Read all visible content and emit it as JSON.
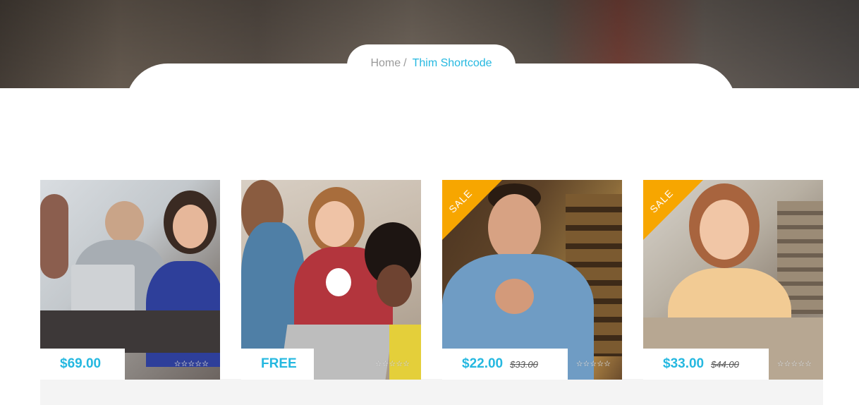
{
  "breadcrumb": {
    "home": "Home",
    "separator": "/",
    "current": "Thim Shortcode"
  },
  "products": [
    {
      "price": "$69.00",
      "old_price": "",
      "sale": false,
      "sale_label": "",
      "rating": "☆☆☆☆☆"
    },
    {
      "price": "FREE",
      "old_price": "",
      "sale": false,
      "sale_label": "",
      "rating": "☆☆☆☆☆"
    },
    {
      "price": "$22.00",
      "old_price": "$33.00",
      "sale": true,
      "sale_label": "SALE",
      "rating": "☆☆☆☆☆"
    },
    {
      "price": "$33.00",
      "old_price": "$44.00",
      "sale": true,
      "sale_label": "SALE",
      "rating": "☆☆☆☆☆"
    }
  ],
  "colors": {
    "accent": "#25b8e0",
    "sale": "#f7a600"
  }
}
